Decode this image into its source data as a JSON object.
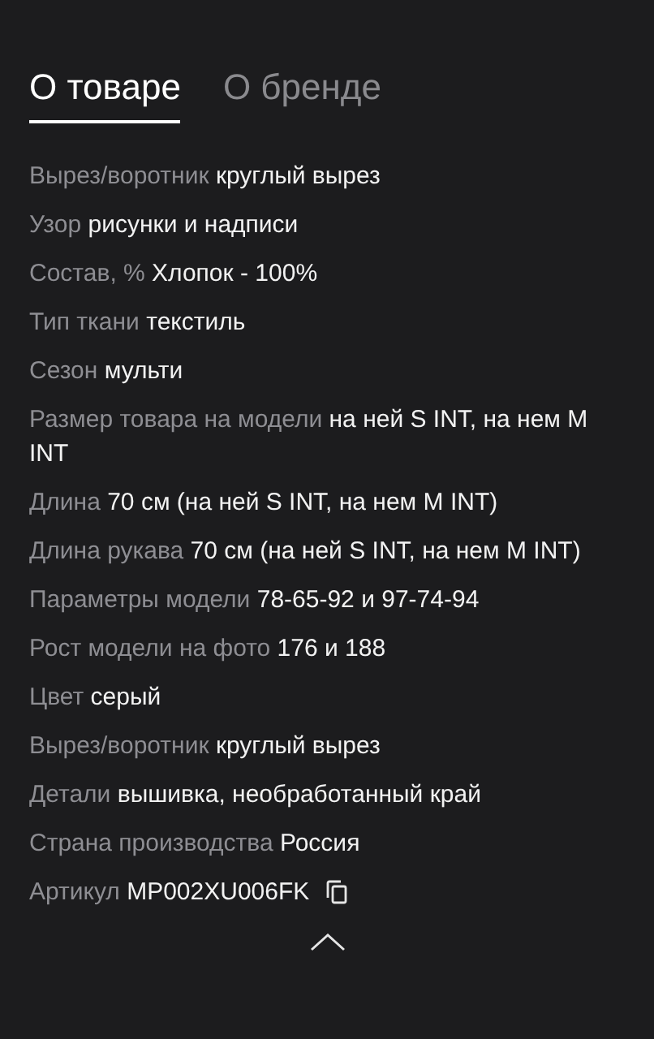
{
  "tabs": [
    {
      "label": "О товаре",
      "selected": true
    },
    {
      "label": "О бренде",
      "selected": false
    }
  ],
  "specs": [
    {
      "kind": "plain",
      "label": "Вырез/воротник",
      "value": "круглый вырез"
    },
    {
      "kind": "plain",
      "label": "Узор",
      "value": "рисунки и надписи"
    },
    {
      "kind": "plain",
      "label": "Состав, %",
      "value": "Хлопок - 100%"
    },
    {
      "kind": "plain",
      "label": "Тип ткани",
      "value": "текстиль"
    },
    {
      "kind": "plain",
      "label": "Сезон",
      "value": "мульти"
    },
    {
      "kind": "plain",
      "label": "Размер товара на модели",
      "value": "на ней S INT, на нем M INT"
    },
    {
      "kind": "plain",
      "label": "Длина",
      "value": "70 см (на ней S INT, на нем M INT)"
    },
    {
      "kind": "plain",
      "label": "Длина рукава",
      "value": "70 см (на ней S INT, на нем M INT)"
    },
    {
      "kind": "plain",
      "label": "Параметры модели",
      "value": "78-65-92 и 97-74-94"
    },
    {
      "kind": "plain",
      "label": "Рост модели на фото",
      "value": "176 и 188"
    },
    {
      "kind": "plain",
      "label": "Цвет",
      "value": "серый"
    },
    {
      "kind": "plain",
      "label": "Вырез/воротник",
      "value": "круглый вырез"
    },
    {
      "kind": "plain",
      "label": "Детали",
      "value": "вышивка, необработанный край"
    },
    {
      "kind": "plain",
      "label": "Страна производства",
      "value": "Россия"
    },
    {
      "kind": "copyable",
      "label": "Артикул",
      "value": "MP002XU006FK"
    }
  ]
}
